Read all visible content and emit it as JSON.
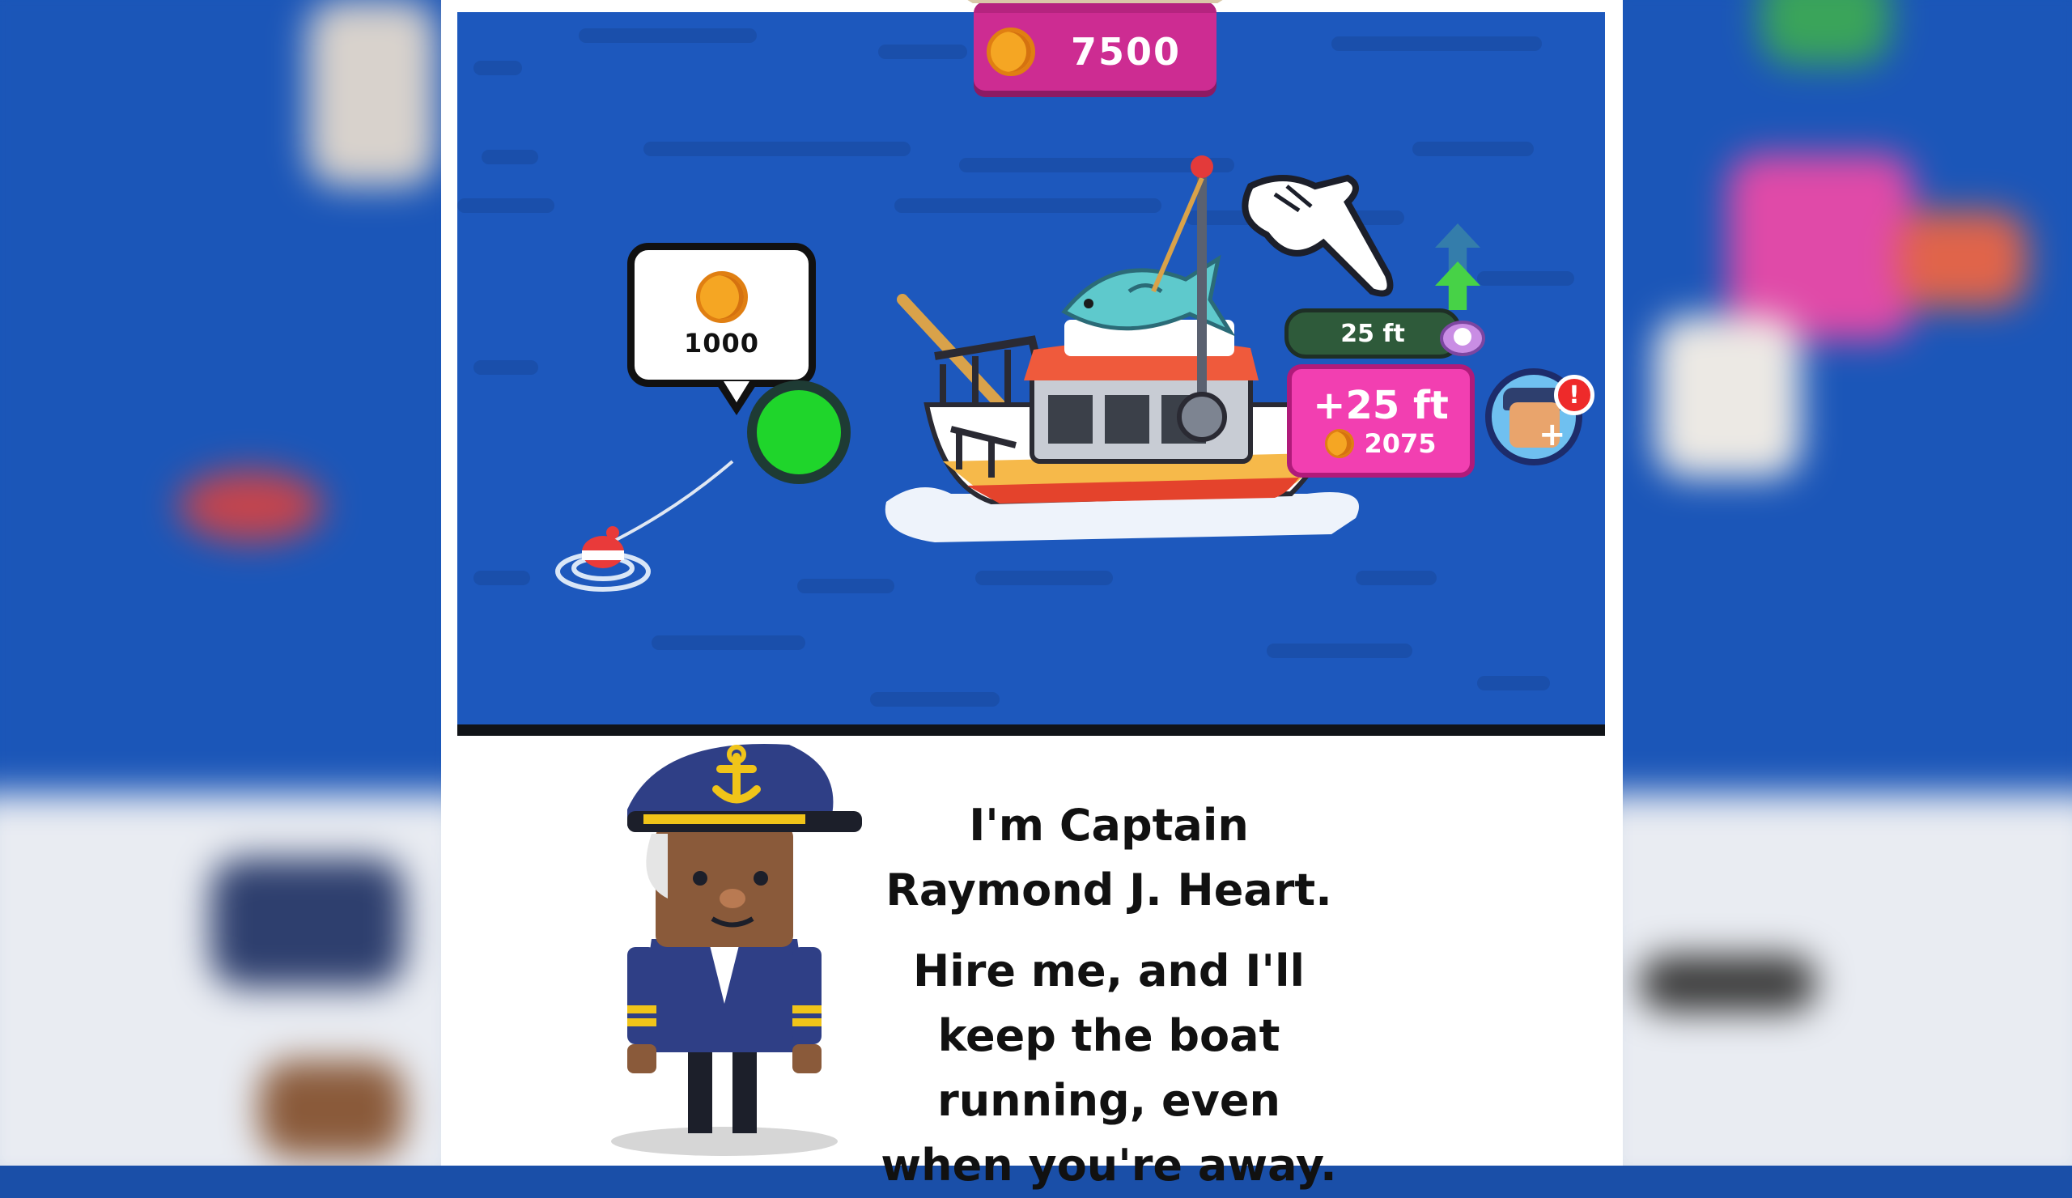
{
  "hud": {
    "coins": "7500"
  },
  "bobber_reward": {
    "coins": "1000"
  },
  "fishing_line": {
    "depth_label": "25 ft"
  },
  "upgrade": {
    "gain_label": "+25 ft",
    "cost": "2075"
  },
  "dialog": {
    "line1": "I'm Captain Raymond J. Heart.",
    "line2": "Hire me, and I'll keep the boat running, even when you're away."
  },
  "badges": {
    "alert": "!"
  },
  "icons": {
    "coin": "coin-icon",
    "hand": "pointing-hand-icon",
    "arrow": "upgrade-arrow-icon",
    "hire": "hire-crew-icon",
    "pearl": "pearl-shell-icon"
  },
  "colors": {
    "sea": "#1d58bd",
    "coin_bar": "#cd2c92",
    "upgrade_card": "#f23fb1",
    "cast_button": "#1fd52b",
    "alert": "#ee2a2a"
  }
}
